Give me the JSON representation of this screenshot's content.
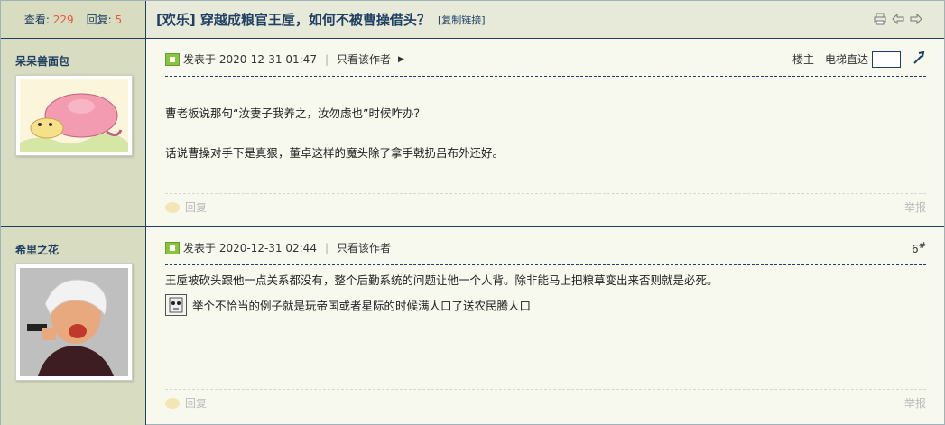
{
  "thread": {
    "views_label": "查看:",
    "views": "229",
    "replies_label": "回复:",
    "replies": "5",
    "title": "[欢乐] 穿越成粮官王垕，如何不被曹操借头？",
    "copy_link": "[复制链接]"
  },
  "posts": [
    {
      "username": "呆呆兽面包",
      "posted_label": "发表于 2020-12-31 01:47",
      "only_author": "只看该作者",
      "floor_label": "楼主",
      "elevator_label": "电梯直达",
      "content": [
        "曹老板说那句“汝妻子我养之，汝勿虑也”时候咋办？",
        "话说曹操对手下是真狠，董卓这样的魔头除了拿手戟扔吕布外还好。"
      ],
      "reply": "回复",
      "report": "举报"
    },
    {
      "username": "希里之花",
      "posted_label": "发表于 2020-12-31 02:44",
      "only_author": "只看该作者",
      "floor_number": "6",
      "floor_suffix": "#",
      "content": [
        "王垕被砍头跟他一点关系都没有，整个后勤系统的问题让他一个人背。除非能马上把粮草变出来否则就是必死。",
        "举个不恰当的例子就是玩帝国或者星际的时候满人口了送农民腾人口"
      ],
      "reply": "回复",
      "report": "举报"
    }
  ],
  "colors": {
    "sidebar": "#d8dcc1",
    "border": "#1f3f63",
    "accent_number": "#e9573f",
    "background": "#f7f8ee"
  },
  "icons": [
    "print-icon",
    "prev-thread-icon",
    "next-thread-icon",
    "post-icon",
    "elevator-go-icon",
    "reply-icon",
    "emoticon-icon"
  ]
}
